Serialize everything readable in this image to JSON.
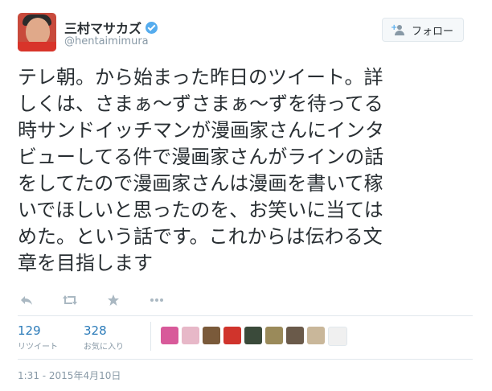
{
  "author": {
    "display_name": "三村マサカズ",
    "username": "@hentaimimura"
  },
  "follow_button": {
    "label": "フォロー"
  },
  "tweet": {
    "lines": [
      "テレ朝。から始まった昨日のツイート。詳",
      "しくは、さまぁ～ずさまぁ～ずを待ってる",
      "時サンドイッチマンが漫画家さんにインタ",
      "ビューしてる件で漫画家さんがラインの話",
      "をしてたので漫画家さんは漫画を書いて稼",
      "いでほしいと思ったのを、お笑いに当ては",
      "めた。という話です。これからは伝わる文",
      "章を目指します"
    ]
  },
  "actions": {
    "reply_icon": "reply-icon",
    "retweet_icon": "retweet-icon",
    "favorite_icon": "star-icon",
    "more_icon": "more-dots-icon"
  },
  "stats": {
    "retweets": {
      "count": "129",
      "label": "リツイート"
    },
    "favorites": {
      "count": "328",
      "label": "お気に入り"
    }
  },
  "favoriters": [
    {
      "color": "#d85a9a"
    },
    {
      "color": "#e7b8c8"
    },
    {
      "color": "#7a5a3a"
    },
    {
      "color": "#d0342c"
    },
    {
      "color": "#3a4a3a"
    },
    {
      "color": "#9a8a5a"
    },
    {
      "color": "#6a5a4a"
    },
    {
      "color": "#c9b79a"
    },
    {
      "color": "#f0f0f0"
    }
  ],
  "timestamp": "1:31 - 2015年4月10日"
}
